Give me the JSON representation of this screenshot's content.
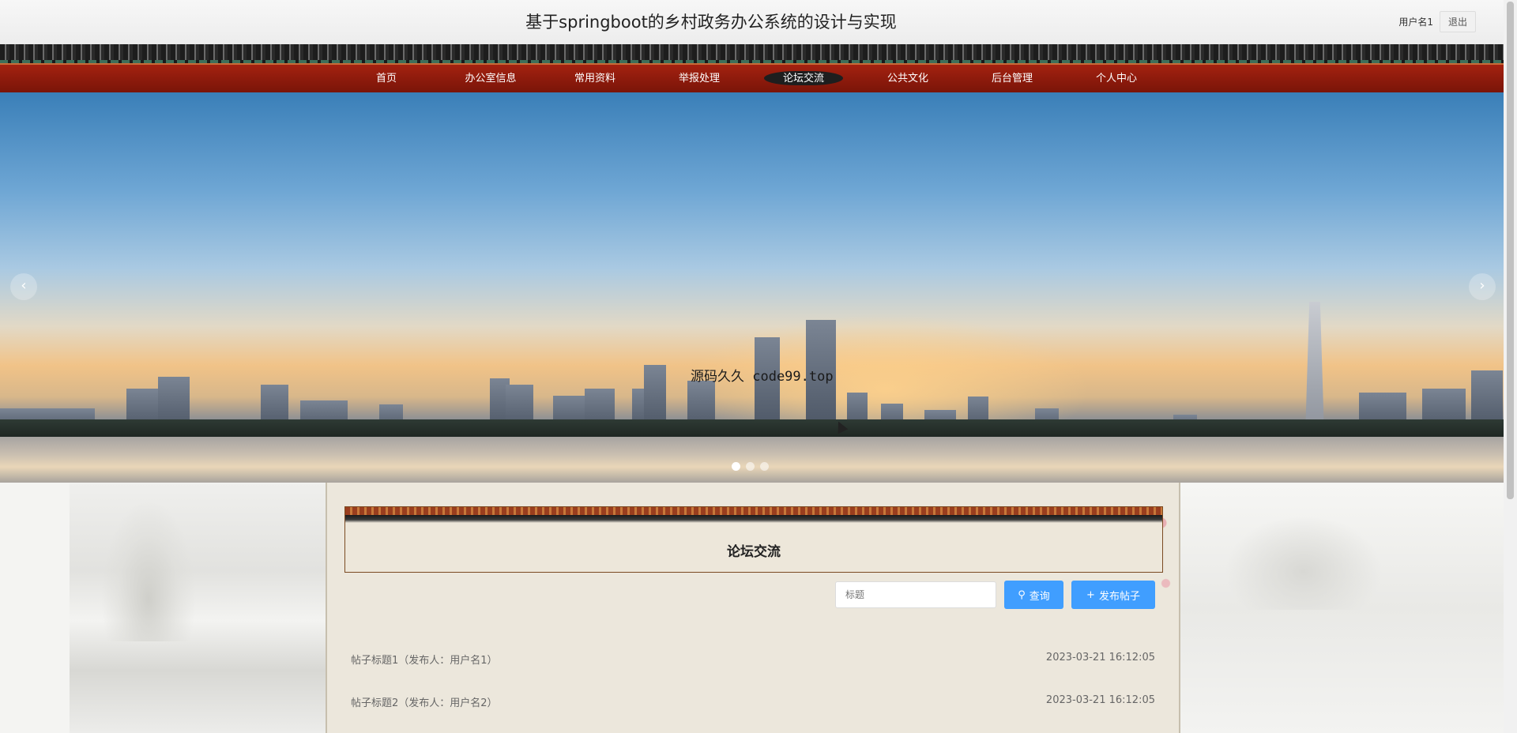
{
  "header": {
    "title": "基于springboot的乡村政务办公系统的设计与实现",
    "user_name": "用户名1",
    "logout_label": "退出"
  },
  "nav": {
    "items": [
      "首页",
      "办公室信息",
      "常用资料",
      "举报处理",
      "论坛交流",
      "公共文化",
      "后台管理",
      "个人中心"
    ],
    "active_index": 4
  },
  "banner": {
    "caption": "源码久久 code99.top",
    "prev_icon": "chevron-left-icon",
    "next_icon": "chevron-right-icon",
    "slide_count": 3,
    "active_slide": 1
  },
  "forum": {
    "title": "论坛交流",
    "search_placeholder": "标题",
    "query_label": "查询",
    "post_label": "发布帖子",
    "posts": [
      {
        "title": "帖子标题1（发布人：用户名1）",
        "time": "2023-03-21 16:12:05"
      },
      {
        "title": "帖子标题2（发布人：用户名2）",
        "time": "2023-03-21 16:12:05"
      }
    ]
  },
  "colors": {
    "nav_red": "#8c1a0c",
    "button_blue": "#409eff"
  }
}
